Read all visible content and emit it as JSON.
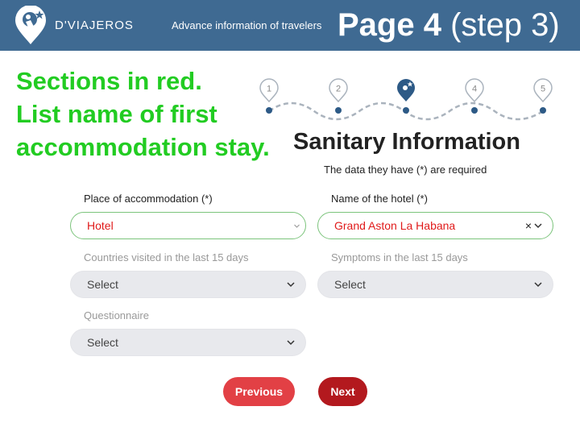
{
  "header": {
    "brand": "D'VIAJEROS",
    "tagline": "Advance information of travelers",
    "page_title_bold": "Page 4",
    "page_title_step": "(step 3)"
  },
  "annotation": {
    "lines": [
      "Sections in red.",
      "List name of first",
      "accommodation stay."
    ]
  },
  "stepper": {
    "steps": [
      "1",
      "2",
      "",
      "4",
      "5"
    ],
    "current_step": 3,
    "total_steps": 5
  },
  "form": {
    "title": "Sanitary Information",
    "required_note": "The data they have (*) are required",
    "fields": {
      "accommodation": {
        "label": "Place of accommodation (*)",
        "value": "Hotel"
      },
      "hotel_name": {
        "label": "Name of the hotel (*)",
        "value": "Grand Aston La Habana",
        "clear": "×"
      },
      "countries": {
        "label": "Countries visited in the last 15 days",
        "value": "Select"
      },
      "symptoms": {
        "label": "Symptoms in the last 15 days",
        "value": "Select"
      },
      "questionnaire": {
        "label": "Questionnaire",
        "value": "Select"
      }
    },
    "buttons": {
      "previous": "Previous",
      "next": "Next"
    }
  },
  "colors": {
    "header_bg": "#3f6a92",
    "annotation": "#22cc22",
    "field_value_red": "#e01a1a",
    "active_border": "#7cc47c",
    "inactive_bg": "#e8e9ed",
    "previous_button": "#e24045",
    "next_button": "#b3191e",
    "stepper_path": "#aab3bd",
    "stepper_dot": "#2d5a86"
  }
}
